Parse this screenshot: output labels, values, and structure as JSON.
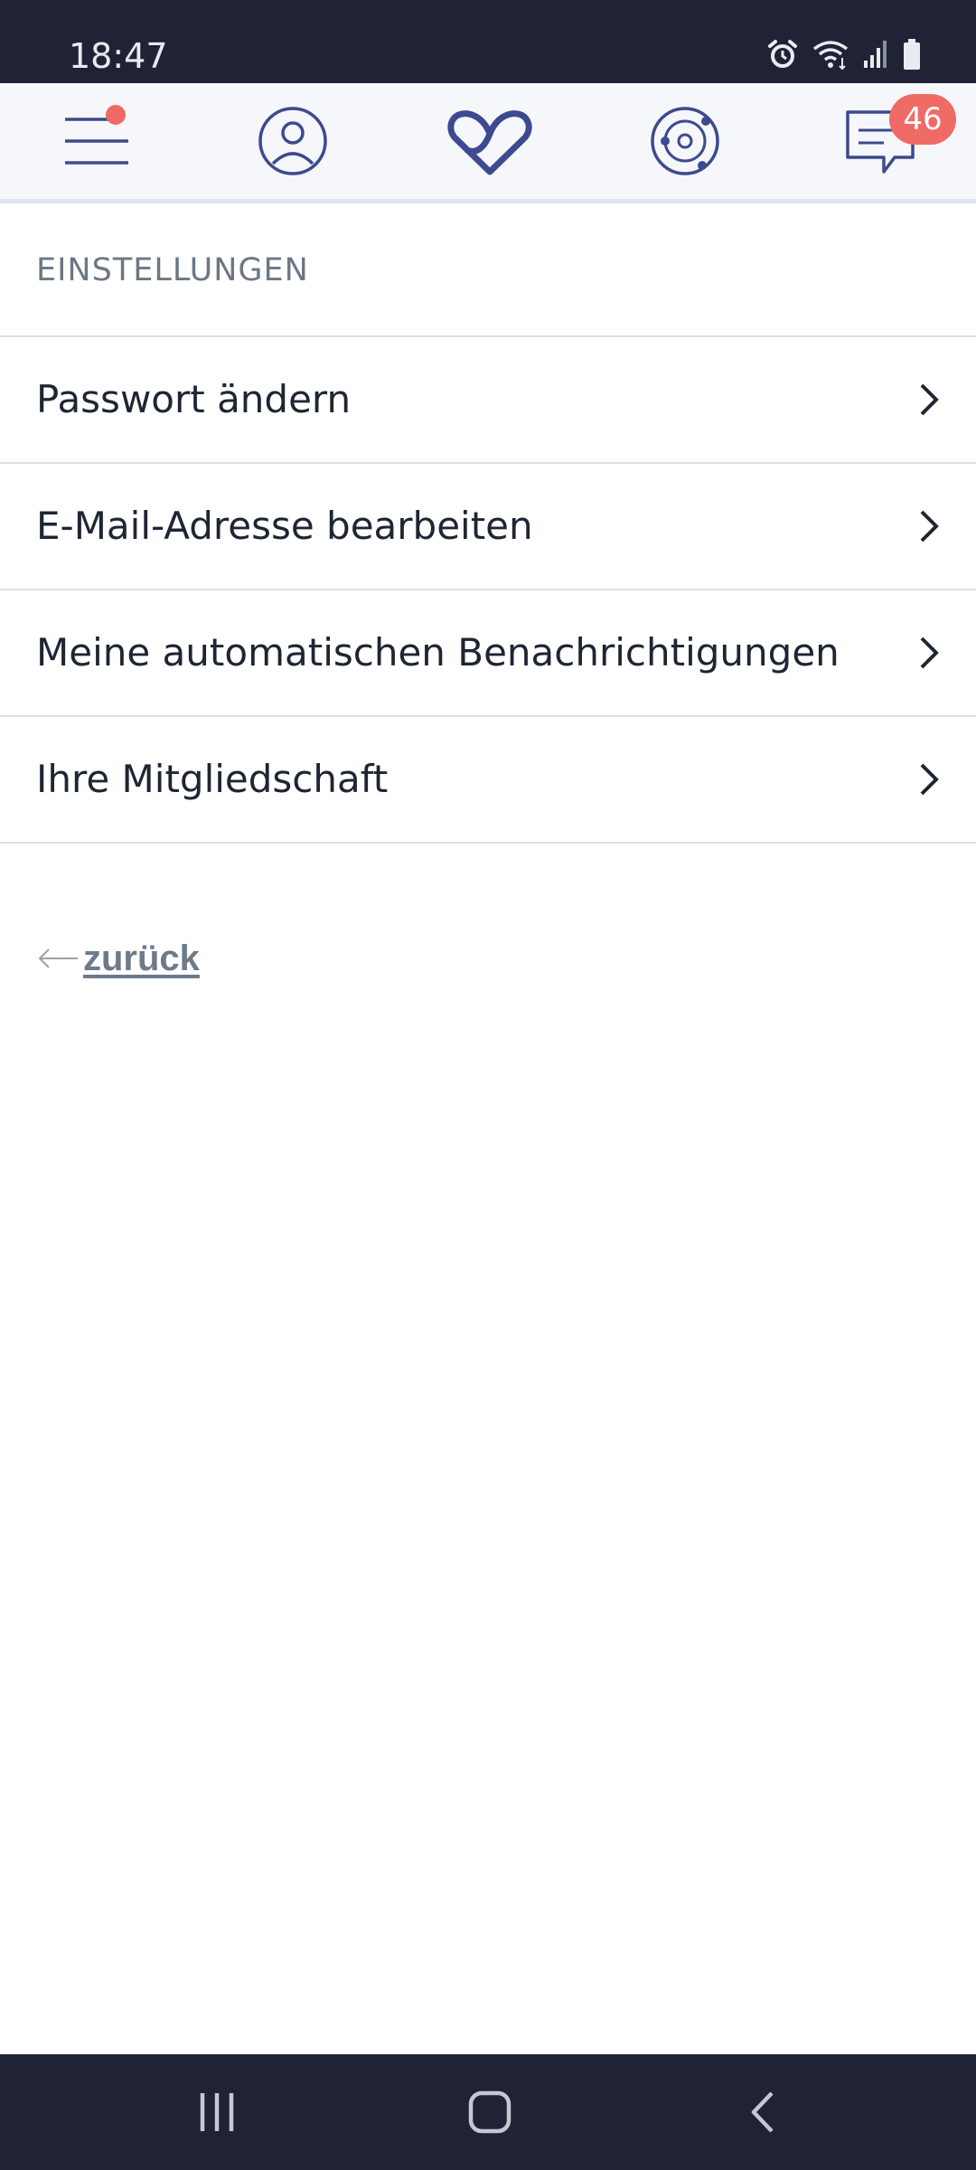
{
  "status_bar": {
    "time": "18:47",
    "icons": [
      "alarm-icon",
      "wifi-icon",
      "signal-icon",
      "battery-icon"
    ]
  },
  "top_nav": {
    "items": [
      {
        "name": "menu",
        "icon": "hamburger-menu-icon",
        "has_notification_dot": true
      },
      {
        "name": "profile",
        "icon": "user-circle-icon"
      },
      {
        "name": "matches",
        "icon": "infinity-heart-icon"
      },
      {
        "name": "discover",
        "icon": "orbit-icon"
      },
      {
        "name": "messages",
        "icon": "chat-icon",
        "badge": "46"
      }
    ]
  },
  "settings": {
    "title": "EINSTELLUNGEN",
    "items": [
      {
        "label": "Passwort ändern"
      },
      {
        "label": "E-Mail-Adresse bearbeiten"
      },
      {
        "label": "Meine automatischen Benachrichtigungen"
      },
      {
        "label": "Ihre Mitgliedschaft"
      }
    ]
  },
  "back_link": {
    "label": "zurück"
  },
  "colors": {
    "status_bar_bg": "#1f2335",
    "nav_icon": "#3d4a8f",
    "badge": "#f06a66",
    "section_title": "#6c7785",
    "item_text": "#1e2533",
    "divider": "#dcdfe6",
    "back_link": "#6d7a8a"
  }
}
